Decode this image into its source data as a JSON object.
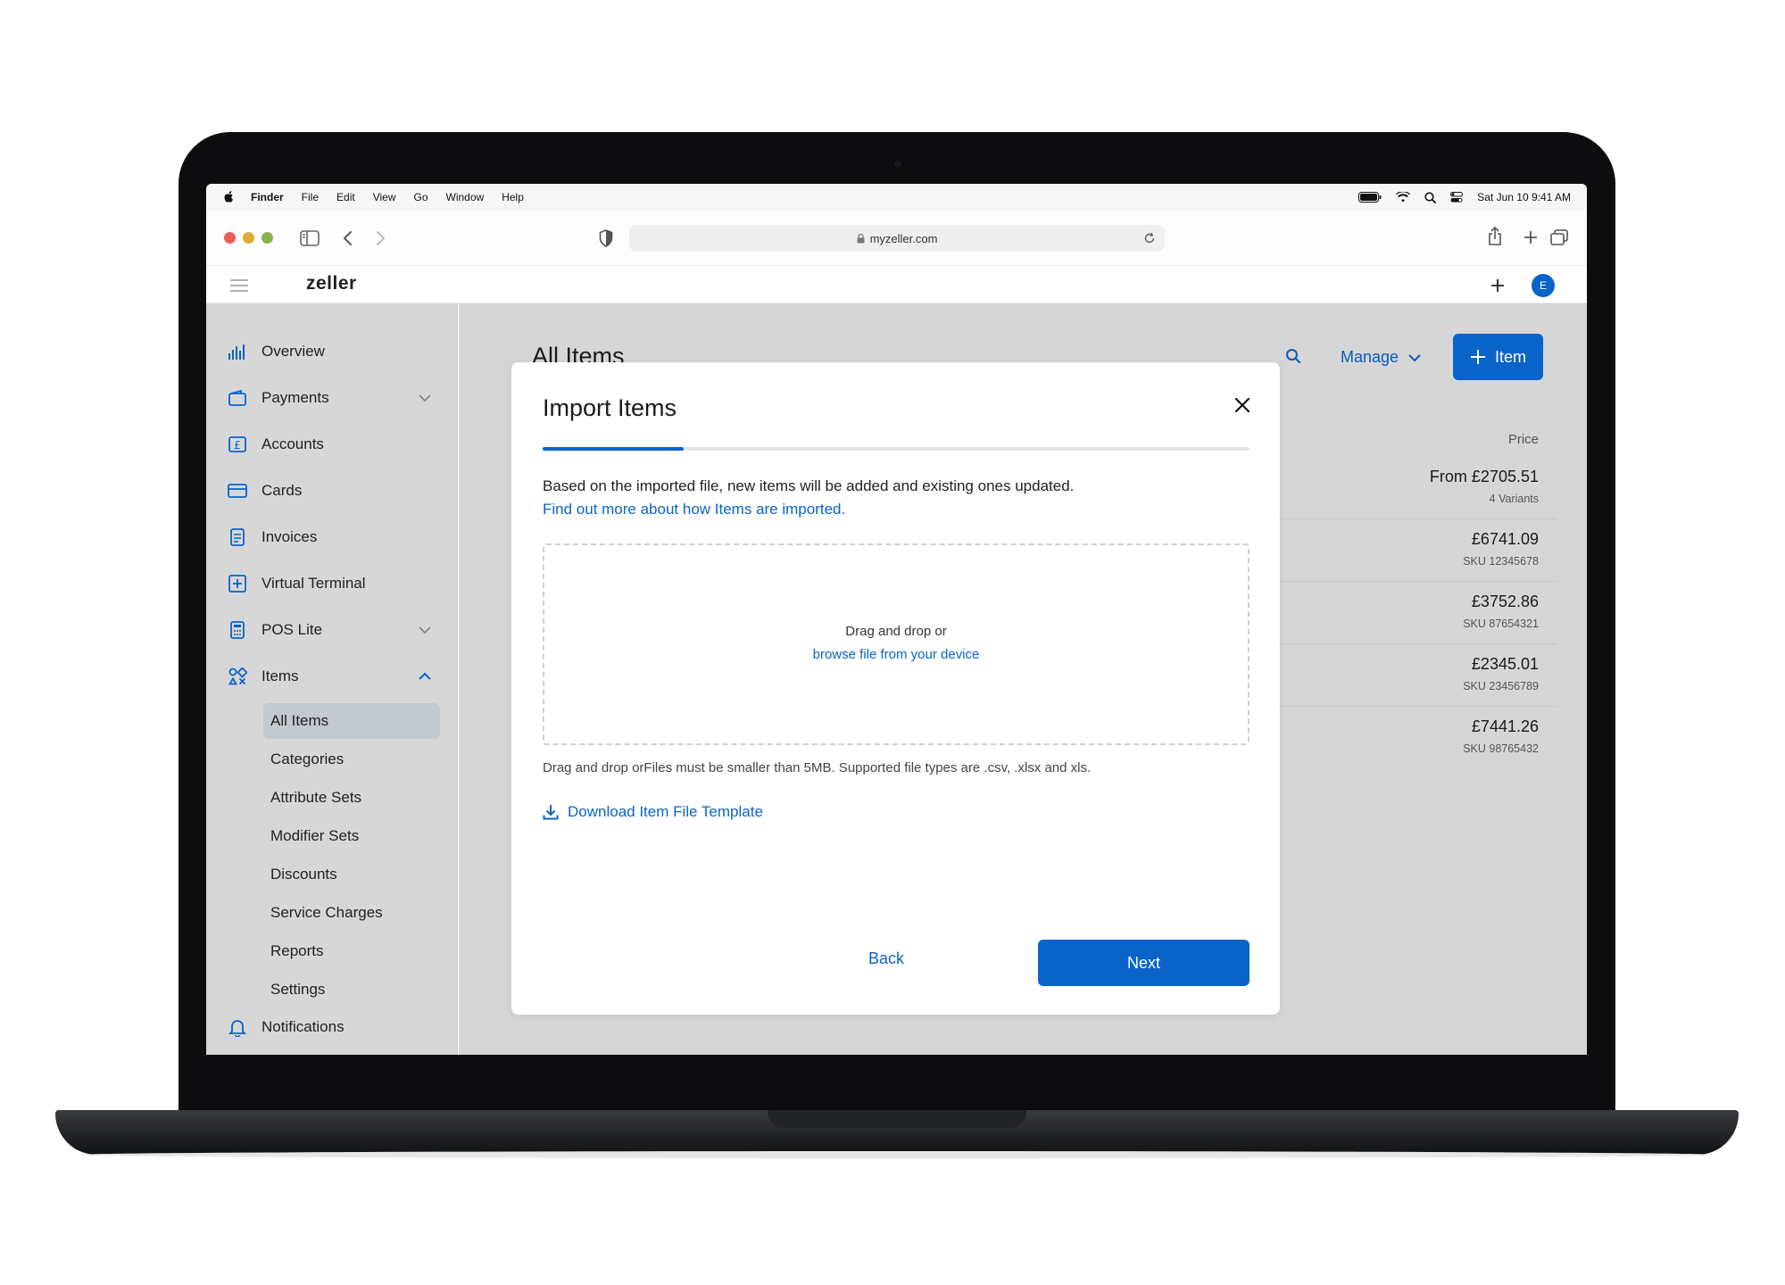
{
  "menubar": {
    "app": "Finder",
    "menus": [
      "File",
      "Edit",
      "View",
      "Go",
      "Window",
      "Help"
    ],
    "datetime": "Sat Jun 10  9:41 AM"
  },
  "browser": {
    "url": "myzeller.com"
  },
  "header": {
    "logo": "zeller",
    "avatar_initial": "E"
  },
  "sidebar": {
    "items": [
      {
        "label": "Overview",
        "icon": "chart-icon"
      },
      {
        "label": "Payments",
        "icon": "wallet-icon"
      },
      {
        "label": "Accounts",
        "icon": "pound-icon"
      },
      {
        "label": "Cards",
        "icon": "card-icon"
      },
      {
        "label": "Invoices",
        "icon": "document-icon"
      },
      {
        "label": "Virtual Terminal",
        "icon": "plus-box-icon"
      },
      {
        "label": "POS Lite",
        "icon": "calculator-icon"
      },
      {
        "label": "Items",
        "icon": "shapes-icon"
      }
    ],
    "sub_items": [
      "All Items",
      "Categories",
      "Attribute Sets",
      "Modifier Sets",
      "Discounts",
      "Service Charges",
      "Reports",
      "Settings"
    ],
    "bottom_item": {
      "label": "Notifications",
      "icon": "bell-icon"
    }
  },
  "main": {
    "title": "All Items",
    "manage_label": "Manage",
    "add_item_label": "Item",
    "price_header": "Price",
    "rows": [
      {
        "price": "From £2705.51",
        "sub": "4 Variants"
      },
      {
        "price": "£6741.09",
        "sub": "SKU 12345678"
      },
      {
        "price": "£3752.86",
        "sub": "SKU 87654321"
      },
      {
        "price": "£2345.01",
        "sub": "SKU 23456789"
      },
      {
        "price": "£7441.26",
        "sub": "SKU 98765432"
      }
    ]
  },
  "modal": {
    "title": "Import Items",
    "progress": 0.2,
    "description": "Based on the imported file, new items will be added and existing ones updated.",
    "description_link": "Find out more about how Items are imported.",
    "dropzone_text": "Drag and drop or",
    "dropzone_link": "browse file from your device",
    "help_text": "Drag and drop orFiles must be smaller than 5MB. Supported file types are .csv, .xlsx and xls.",
    "download_label": "Download Item File Template",
    "back_label": "Back",
    "next_label": "Next"
  },
  "colors": {
    "accent": "#0a63c9",
    "sidebar_bg": "#d7d7d7"
  }
}
